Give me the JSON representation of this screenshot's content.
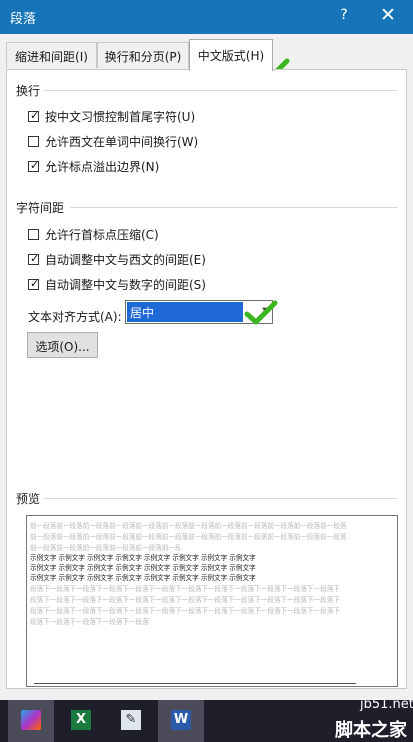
{
  "dialog": {
    "title": "段落",
    "help_glyph": "?",
    "close_glyph": "✕"
  },
  "tabs": [
    {
      "label": "缩进和间距(I)",
      "active": false
    },
    {
      "label": "换行和分页(P)",
      "active": false
    },
    {
      "label": "中文版式(H)",
      "active": true
    }
  ],
  "line_break": {
    "heading": "换行",
    "options": [
      {
        "label": "按中文习惯控制首尾字符(U)",
        "checked": true
      },
      {
        "label": "允许西文在单词中间换行(W)",
        "checked": false
      },
      {
        "label": "允许标点溢出边界(N)",
        "checked": true
      }
    ]
  },
  "char_spacing": {
    "heading": "字符间距",
    "options": [
      {
        "label": "允许行首标点压缩(C)",
        "checked": false
      },
      {
        "label": "自动调整中文与西文的间距(E)",
        "checked": true
      },
      {
        "label": "自动调整中文与数字的间距(S)",
        "checked": true
      }
    ],
    "align_label": "文本对齐方式(A):",
    "align_value": "居中",
    "options_button": "选项(O)..."
  },
  "preview": {
    "heading": "预览",
    "prev_para": "前一段落前一段落前一段落前一段落前一段落前一段落前一段落前一段落前一段落前一段落前一段落前一段落",
    "sample_text": "示例文字 示例文字 示例文字 示例文字 示例文字 示例文字 示例文字 示例文字",
    "next_para": "段落下一段落下一段落下一段落下一段落下一段落下一段落下一段落下一段落下一段落下一段落下一段落下"
  },
  "taskbar": {
    "items": [
      "photo-app-icon",
      "excel-icon",
      "notepad-icon",
      "word-icon"
    ]
  },
  "watermark": {
    "line1": "jb51.net",
    "line2": "脚本之家"
  },
  "colors": {
    "titlebar": "#1675b8",
    "selection": "#1e69d6",
    "check_badge": "#3cb521"
  }
}
